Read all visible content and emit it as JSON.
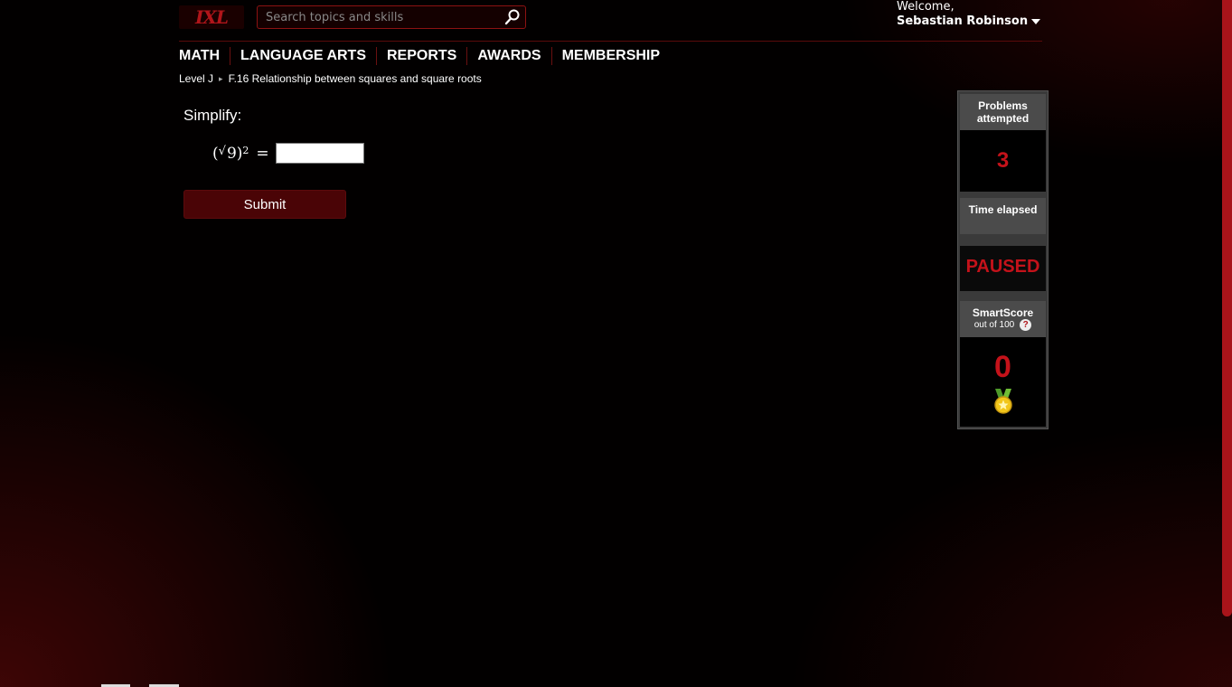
{
  "header": {
    "logo_text": "IXL",
    "search_placeholder": "Search topics and skills",
    "welcome": "Welcome,",
    "user_name": "Sebastian Robinson"
  },
  "nav": {
    "items": [
      "MATH",
      "LANGUAGE ARTS",
      "REPORTS",
      "AWARDS",
      "MEMBERSHIP"
    ]
  },
  "breadcrumb": {
    "level": "Level J",
    "skill": "F.16 Relationship between squares and square roots"
  },
  "question": {
    "prompt": "Simplify:",
    "expr_open": "(",
    "radical": "√",
    "radicand": "9",
    "expr_close": ")",
    "exponent": "2",
    "equals": "=",
    "answer_value": "",
    "submit_label": "Submit"
  },
  "stats": {
    "problems_label": "Problems attempted",
    "problems_value": "3",
    "time_label": "Time elapsed",
    "time_value": "PAUSED",
    "score_label": "SmartScore",
    "score_sublabel": "out of 100",
    "help_symbol": "?",
    "score_value": "0"
  },
  "colors": {
    "accent": "#b0151a",
    "submit_bg": "#4a0406",
    "stat_value": "#c4121a"
  },
  "icons": {
    "search": "search-icon",
    "medal": "medal-icon",
    "help": "help-icon"
  }
}
